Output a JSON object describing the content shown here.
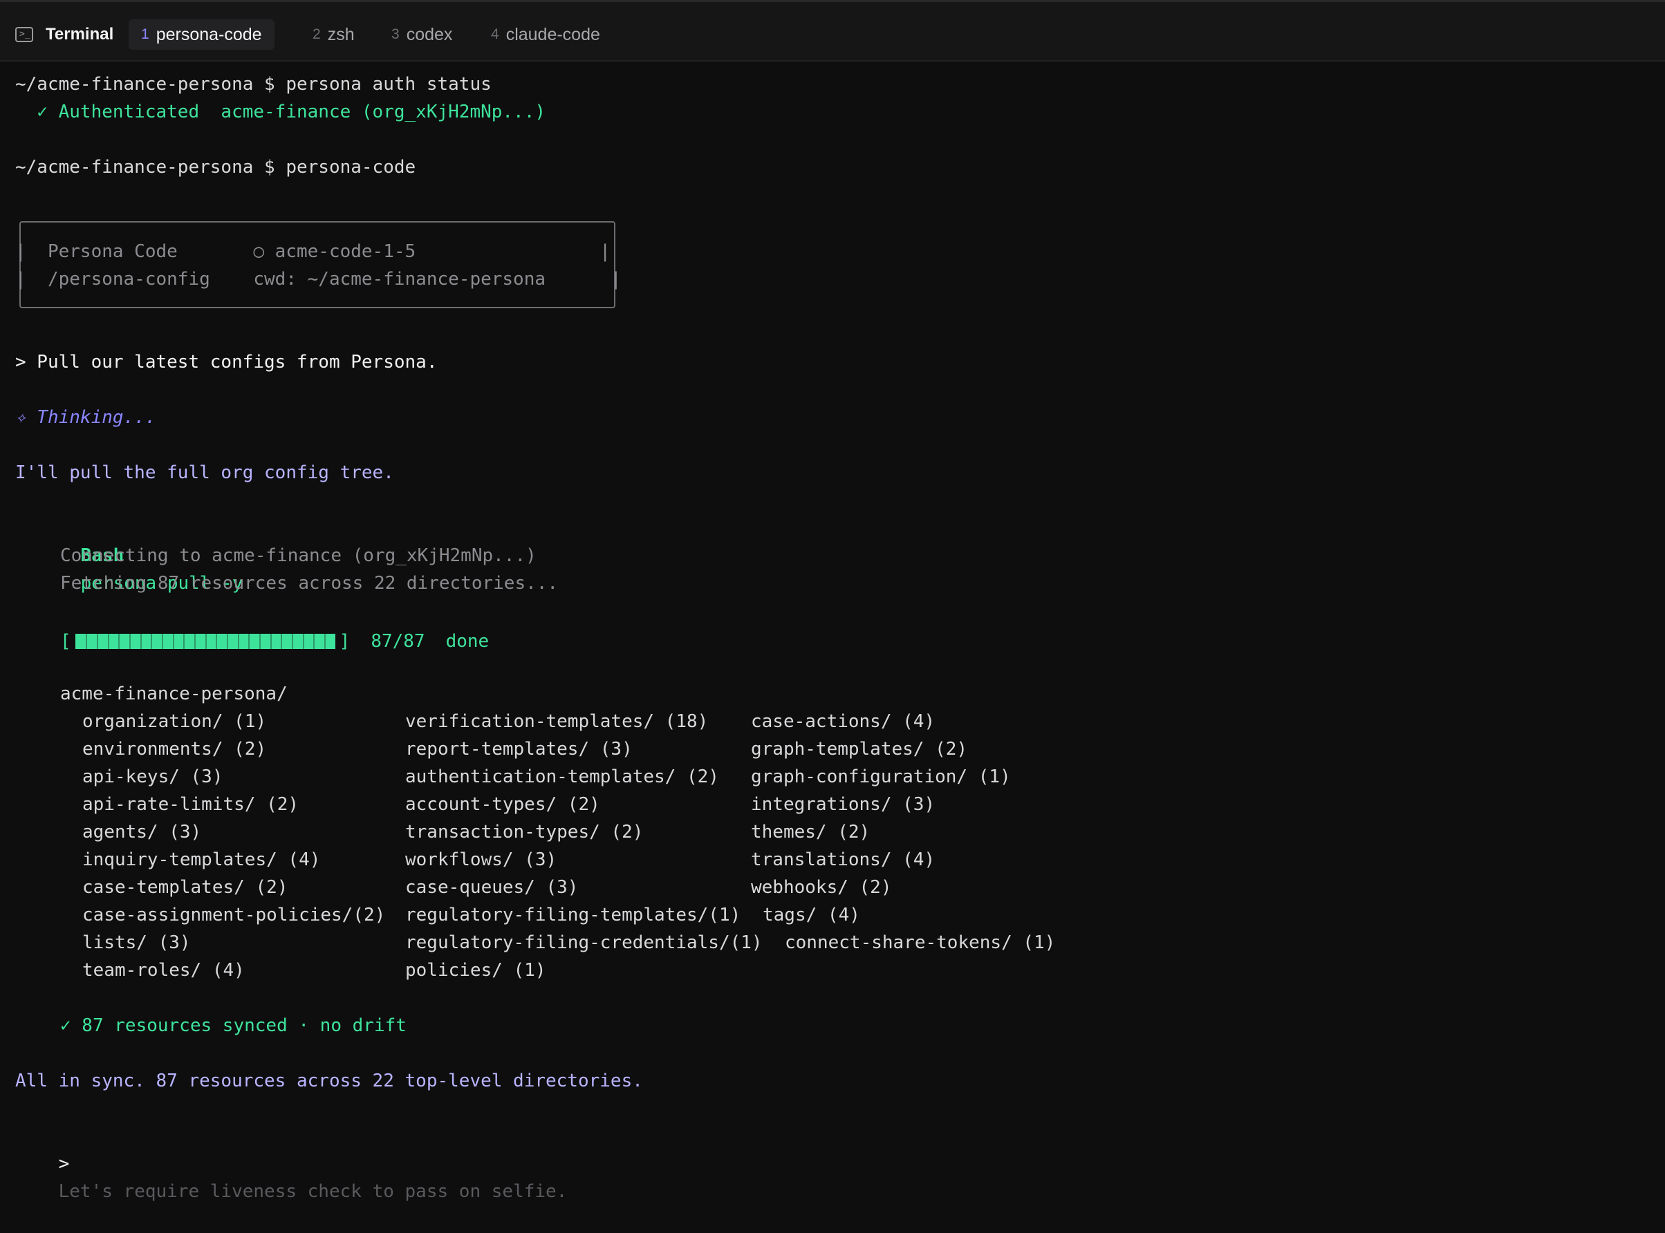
{
  "tabbar": {
    "app_title": "Terminal",
    "tabs": [
      {
        "num": "1",
        "label": "persona-code",
        "active": true
      },
      {
        "num": "2",
        "label": "zsh",
        "active": false
      },
      {
        "num": "3",
        "label": "codex",
        "active": false
      },
      {
        "num": "4",
        "label": "claude-code",
        "active": false
      }
    ]
  },
  "session": {
    "cmd1": "~/acme-finance-persona $ persona auth status",
    "auth_result": "  ✓ Authenticated  acme-finance (org_xKjH2mNp...)",
    "cmd2": "~/acme-finance-persona $ persona-code",
    "banner": {
      "row1": "|  Persona Code       ○ acme-code-1-5                 |",
      "row2": "|  /persona-config    cwd: ~/acme-finance-persona      |"
    },
    "user_prompt": "> Pull our latest configs from Persona.",
    "thinking": "✧ Thinking...",
    "assistant_intro": "I'll pull the full org config tree.",
    "bash_label": "Bash",
    "bash_command": "persona pull -y",
    "output_line1": "Connecting to acme-finance (org_xKjH2mNp...)",
    "output_line2": "Fetching 87 resources across 22 directories...",
    "progress": {
      "fraction": 1.0,
      "open": "[",
      "close": "]",
      "count": "87/87",
      "status": "done"
    },
    "tree_root": "acme-finance-persona/",
    "tree_col1": [
      "organization/ (1)",
      "environments/ (2)",
      "api-keys/ (3)",
      "api-rate-limits/ (2)",
      "agents/ (3)",
      "inquiry-templates/ (4)",
      "case-templates/ (2)",
      "case-assignment-policies/(2)",
      "lists/ (3)",
      "team-roles/ (4)"
    ],
    "tree_col2": [
      "verification-templates/ (18)",
      "report-templates/ (3)",
      "authentication-templates/ (2)",
      "account-types/ (2)",
      "transaction-types/ (2)",
      "workflows/ (3)",
      "case-queues/ (3)",
      "regulatory-filing-templates/(1)",
      "regulatory-filing-credentials/(1)",
      "policies/ (1)"
    ],
    "tree_col3": [
      "case-actions/ (4)",
      "graph-templates/ (2)",
      "graph-configuration/ (1)",
      "integrations/ (3)",
      "themes/ (2)",
      "translations/ (4)",
      "webhooks/ (2)",
      "tags/ (4)",
      "connect-share-tokens/ (1)",
      ""
    ],
    "sync_result": "✓ 87 resources synced · no drift",
    "assistant_summary": "All in sync. 87 resources across 22 top-level directories.",
    "input_prompt_symbol": ">",
    "input_placeholder": "Let's require liveness check to pass on selfie."
  },
  "colors": {
    "background": "#0e0e0f",
    "success_green": "#3ee39b",
    "assistant_purple": "#b9b4ff",
    "thinking_violet": "#8a86ff",
    "muted_gray": "#8c8c90"
  }
}
